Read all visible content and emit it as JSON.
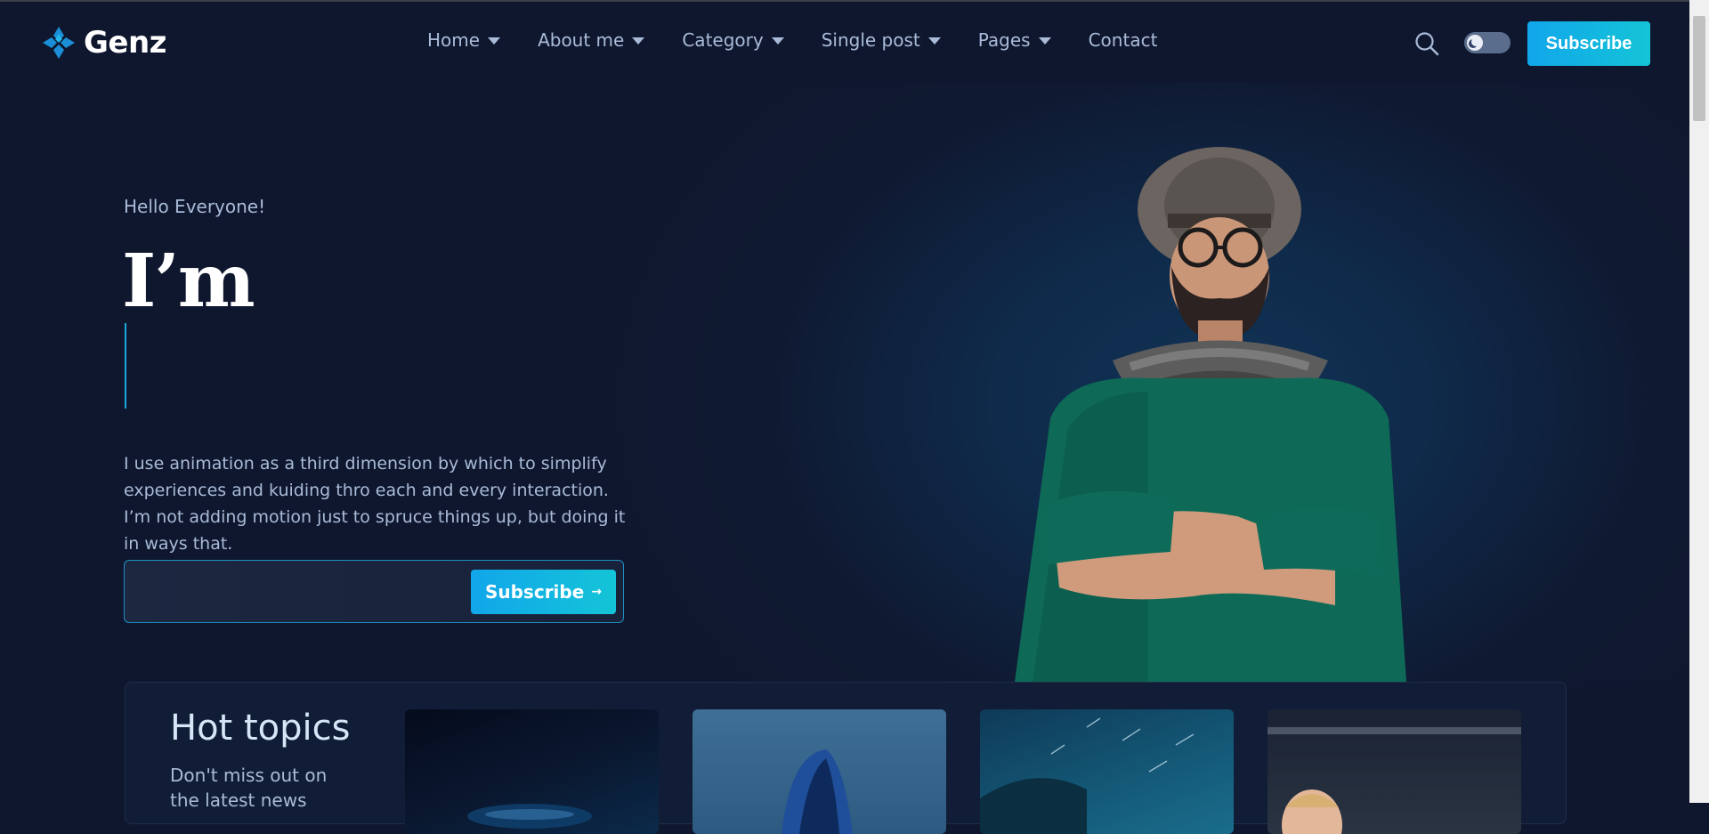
{
  "brand": {
    "name": "Genz"
  },
  "nav": [
    {
      "label": "Home",
      "has_dropdown": true
    },
    {
      "label": "About me",
      "has_dropdown": true
    },
    {
      "label": "Category",
      "has_dropdown": true
    },
    {
      "label": "Single post",
      "has_dropdown": true
    },
    {
      "label": "Pages",
      "has_dropdown": true
    },
    {
      "label": "Contact",
      "has_dropdown": false
    }
  ],
  "header": {
    "subscribe_label": "Subscribe",
    "search_icon": "search-icon",
    "theme_toggle_icon": "moon-icon"
  },
  "hero": {
    "greeting": "Hello Everyone!",
    "headline": "I’m",
    "description": "I use animation as a third dimension by which to simplify experiences and kuiding thro each and every interaction. I’m not adding motion just to spruce things up, but doing it in ways that.",
    "email_value": "",
    "subscribe_label": "Subscribe",
    "subscribe_icon": "arrow-right-icon"
  },
  "hot_topics": {
    "title": "Hot topics",
    "subtitle": "Don't miss out on the latest news"
  },
  "colors": {
    "background": "#0f172e",
    "accent": "#11a6ea",
    "accent_end": "#14c4d7"
  }
}
